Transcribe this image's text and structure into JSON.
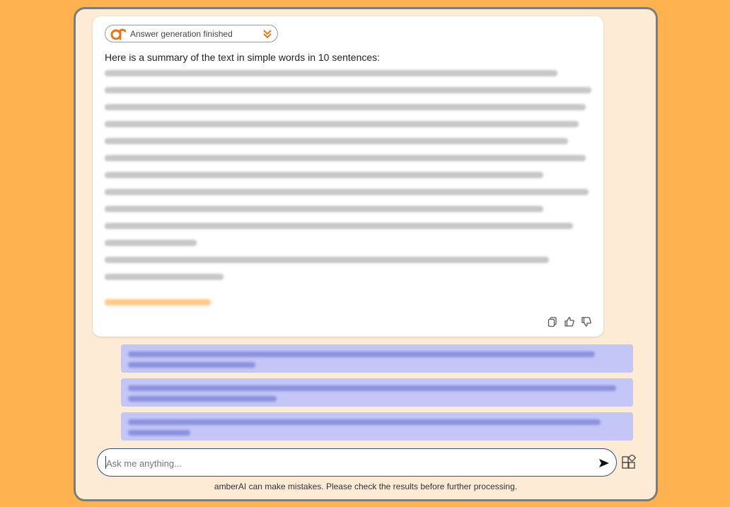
{
  "status": {
    "text": "Answer generation finished",
    "logo_color": "#e8761a",
    "chevron_color": "#e8761a"
  },
  "answer": {
    "intro": "Here is a summary of the text in simple words in 10 sentences:"
  },
  "input": {
    "placeholder": "Ask me anything..."
  },
  "disclaimer": "amberAI can make mistakes. Please check the results before further processing.",
  "icons": {
    "copy": "copy-icon",
    "thumbs_up": "thumbs-up-icon",
    "thumbs_down": "thumbs-down-icon",
    "send": "send-icon",
    "apps": "apps-icon"
  },
  "colors": {
    "background": "#ffb24f",
    "frame": "#fdebd5",
    "suggestion": "#c3c6f6",
    "input_border": "#2f4f7a"
  }
}
